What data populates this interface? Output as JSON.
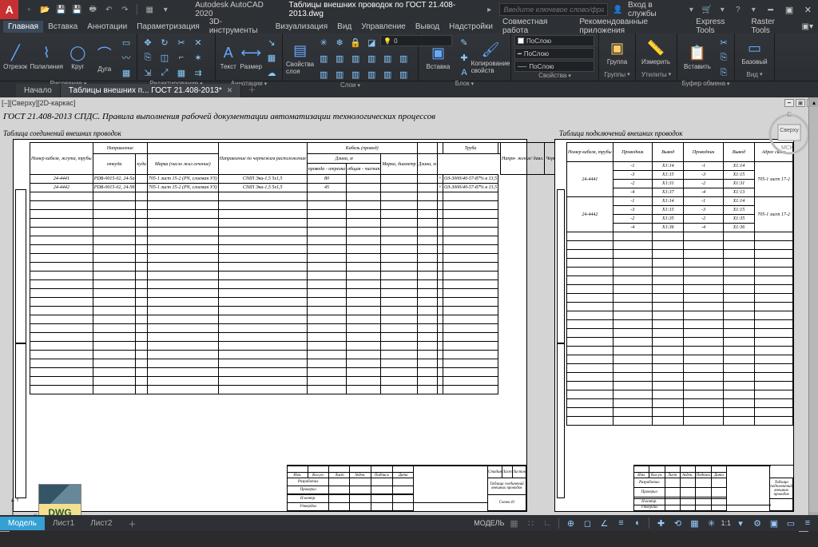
{
  "app": {
    "name": "Autodesk AutoCAD 2020",
    "file": "Таблицы внешних проводок по ГОСТ 21.408-2013.dwg"
  },
  "search": {
    "placeholder": "Введите ключевое слово/фразу"
  },
  "user": {
    "label": "Вход в службы"
  },
  "menu": [
    "Главная",
    "Вставка",
    "Аннотации",
    "Параметризация",
    "3D-инструменты",
    "Визуализация",
    "Вид",
    "Управление",
    "Вывод",
    "Надстройки",
    "Совместная работа",
    "Рекомендованные приложения",
    "Express Tools",
    "Raster Tools"
  ],
  "ribbon": {
    "draw": {
      "title": "Рисование",
      "segment": "Отрезок",
      "polyline": "Полилиния",
      "circle": "Круг",
      "arc": "Дуга"
    },
    "edit": {
      "title": "Редактирование"
    },
    "anno": {
      "title": "Аннотации",
      "text": "Текст",
      "dim": "Размер"
    },
    "layers": {
      "title": "Слои",
      "props": "Свойства\nслоя",
      "combo": "0"
    },
    "block": {
      "title": "Блок",
      "insert": "Вставка",
      "copy": "Копирование\nсвойств"
    },
    "props": {
      "title": "Свойства",
      "bylayer": "ПоСлою"
    },
    "groups": {
      "title": "Группы",
      "group": "Группа"
    },
    "util": {
      "title": "Утилиты",
      "measure": "Измерить"
    },
    "clip": {
      "title": "Буфер обмена",
      "paste": "Вставить"
    },
    "view": {
      "title": "Вид",
      "base": "Базовый"
    }
  },
  "tabs": {
    "start": "Начало",
    "doc": "Таблицы внешних п... ГОСТ 21.408-2013*"
  },
  "viewport": {
    "label": "[–][Сверху][2D-каркас]",
    "cube": "Сверху",
    "wcs": "МСК"
  },
  "heading": "ГОСТ 21.408-2013 СПДС. Правила выполнения рабочей документации автоматизации технологических процессов",
  "captions": {
    "t1": "Таблица соединений внешних проводок",
    "t2": "Таблица подключений внешних проводок"
  },
  "table1": {
    "h1": [
      "Номер кабеля, жгута, трубы",
      "Направление",
      "",
      "Направление по чертежам расположения",
      "Кабель (провод)",
      "",
      "",
      "Труба",
      "",
      "Напря-\nжение/\nдавл.",
      "Чертеж установки"
    ],
    "h2": [
      "",
      "откуда",
      "куда",
      "",
      "Марка (число жил сечение)",
      "Длина, м",
      "",
      "Марка, диаметр",
      "Длина, м",
      "",
      ""
    ],
    "h3": [
      "",
      "",
      "",
      "",
      "",
      "провода - отрезка",
      "общая - чистая",
      "",
      "",
      "",
      ""
    ],
    "rows": [
      [
        "24-4441",
        "РDB-0015-02, 24-5a",
        "",
        "705-1 лист 15-2 (РN, слоемая УЗ)",
        "СNIП Эка-1,5 5х1,5",
        "80",
        "",
        "",
        "",
        "+",
        "ОЗ-3000/40-57-87% в 13,5"
      ],
      [
        "24-4442",
        "РDB-0015-02, 24-5б",
        "",
        "705-1 лист 15-2 (РN, слоемая УЗ)",
        "СNIП Эка-1,5 5х1,5",
        "45",
        "",
        "",
        "",
        "+",
        "ОЗ-3000/40-57-87% в 13,5"
      ]
    ],
    "footer_caption": "Таблица соединений внешних проводок",
    "footer_sheet": "Схема 41"
  },
  "table2": {
    "h1": [
      "Номер кабеля, трубы",
      "Проводник",
      "Вывод",
      "Проводник",
      "Вывод",
      "Адрес связи"
    ],
    "groups": [
      {
        "id": "24-4441",
        "rows": [
          [
            "-1",
            "X1:14",
            "-1",
            "X1:14"
          ],
          [
            "-3",
            "X1:15",
            "-3",
            "X1:15"
          ],
          [
            "-2",
            "X1:31",
            "-2",
            "X1:31"
          ],
          [
            "-4",
            "X1:37",
            "-4",
            "X1:13"
          ]
        ],
        "addr": "705-1 лист 17-2"
      },
      {
        "id": "24-4442",
        "rows": [
          [
            "-1",
            "X1:14",
            "-1",
            "X1:14"
          ],
          [
            "-3",
            "X1:15",
            "-3",
            "X1:15"
          ],
          [
            "-2",
            "X1:35",
            "-2",
            "X1:35"
          ],
          [
            "-4",
            "X1:36",
            "-4",
            "X1:36"
          ]
        ],
        "addr": "705-1 лист 17-2"
      }
    ],
    "footer_caption": "Таблица подключений внешних проводок"
  },
  "dwg": {
    "label": "DWG"
  },
  "status": {
    "model": "Модель",
    "l1": "Лист1",
    "l2": "Лист2",
    "model_btn": "МОДЕЛЬ",
    "scale": "1:1"
  },
  "titleblock": {
    "cols": [
      "Изм.",
      "Кол.уч.",
      "Лист",
      "№док.",
      "Подпись",
      "Дата"
    ],
    "rows": [
      "Разработал",
      "Проверил",
      "",
      "Н.контр.",
      "Утвердил"
    ],
    "r_cols": [
      "Стадия",
      "Лист",
      "Листов"
    ]
  }
}
